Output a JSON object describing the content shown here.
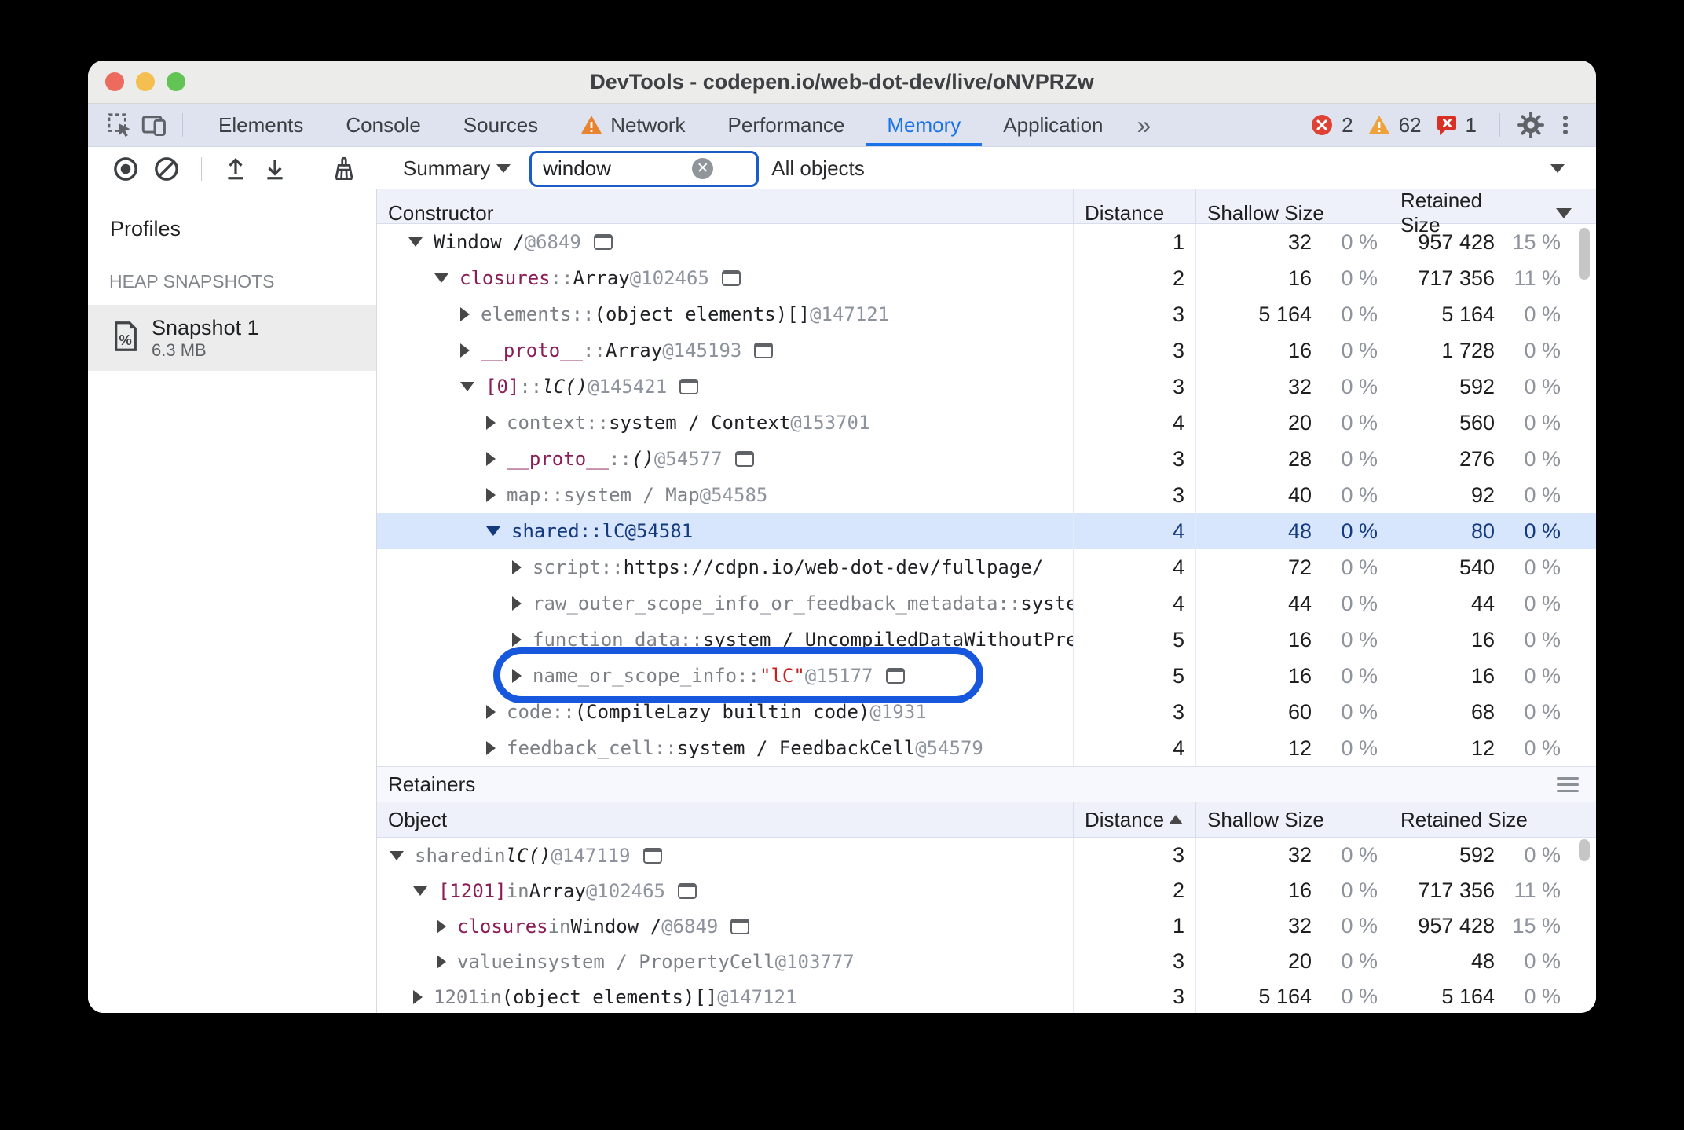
{
  "window": {
    "title": "DevTools - codepen.io/web-dot-dev/live/oNVPRZw"
  },
  "tabbar": {
    "tabs": [
      {
        "label": "Elements"
      },
      {
        "label": "Console"
      },
      {
        "label": "Sources"
      },
      {
        "label": "Network",
        "warning": true
      },
      {
        "label": "Performance"
      },
      {
        "label": "Memory",
        "active": true
      },
      {
        "label": "Application"
      }
    ],
    "overflow_chevron": "»",
    "error_count": "2",
    "warning_count": "62",
    "issue_count": "1"
  },
  "toolbar": {
    "profile_view": "Summary",
    "search_value": "window",
    "filter": "All objects"
  },
  "sidebar": {
    "heading": "Profiles",
    "section": "HEAP SNAPSHOTS",
    "snapshot_name": "Snapshot 1",
    "snapshot_size": "6.3 MB"
  },
  "constructors": {
    "columns": {
      "constructor": "Constructor",
      "distance": "Distance",
      "shallow": "Shallow Size",
      "retained": "Retained Size"
    },
    "sort": {
      "column": "Retained Size",
      "direction": "desc"
    },
    "rows": [
      {
        "indent": 0,
        "state": "expanded",
        "box": true,
        "segments": [
          [
            "Window /  ",
            "obj"
          ],
          [
            "@6849",
            "id"
          ]
        ],
        "distance": "1",
        "shallow": "32",
        "shallow_pct": "0 %",
        "retained": "957 428",
        "retained_pct": "15 %"
      },
      {
        "indent": 1,
        "state": "expanded",
        "box": true,
        "segments": [
          [
            "closures",
            "name"
          ],
          [
            " :: ",
            "gray"
          ],
          [
            "Array",
            "obj"
          ],
          [
            " @102465",
            "id"
          ]
        ],
        "distance": "2",
        "shallow": "16",
        "shallow_pct": "0 %",
        "retained": "717 356",
        "retained_pct": "11 %"
      },
      {
        "indent": 2,
        "state": "collapsed",
        "segments": [
          [
            "elements",
            "gray"
          ],
          [
            " :: ",
            "gray"
          ],
          [
            "(object elements)[]",
            "obj"
          ],
          [
            " @147121",
            "id"
          ]
        ],
        "distance": "3",
        "shallow": "5 164",
        "shallow_pct": "0 %",
        "retained": "5 164",
        "retained_pct": "0 %"
      },
      {
        "indent": 2,
        "state": "collapsed",
        "box": true,
        "segments": [
          [
            "__proto__",
            "name"
          ],
          [
            " :: ",
            "gray"
          ],
          [
            "Array",
            "obj"
          ],
          [
            " @145193",
            "id"
          ]
        ],
        "distance": "3",
        "shallow": "16",
        "shallow_pct": "0 %",
        "retained": "1 728",
        "retained_pct": "0 %"
      },
      {
        "indent": 2,
        "state": "expanded",
        "box": true,
        "segments": [
          [
            "[0]",
            "name"
          ],
          [
            " :: ",
            "gray"
          ],
          [
            "lC()",
            "it"
          ],
          [
            " @145421",
            "id"
          ]
        ],
        "distance": "3",
        "shallow": "32",
        "shallow_pct": "0 %",
        "retained": "592",
        "retained_pct": "0 %"
      },
      {
        "indent": 3,
        "state": "collapsed",
        "segments": [
          [
            "context",
            "gray"
          ],
          [
            " :: ",
            "gray"
          ],
          [
            "system / Context",
            "obj"
          ],
          [
            " @153701",
            "id"
          ]
        ],
        "distance": "4",
        "shallow": "20",
        "shallow_pct": "0 %",
        "retained": "560",
        "retained_pct": "0 %"
      },
      {
        "indent": 3,
        "state": "collapsed",
        "box": true,
        "segments": [
          [
            "__proto__",
            "name"
          ],
          [
            " :: ",
            "gray"
          ],
          [
            "()",
            "it"
          ],
          [
            " @54577",
            "id"
          ]
        ],
        "distance": "3",
        "shallow": "28",
        "shallow_pct": "0 %",
        "retained": "276",
        "retained_pct": "0 %"
      },
      {
        "indent": 3,
        "state": "collapsed",
        "segments": [
          [
            "map",
            "gray"
          ],
          [
            " :: ",
            "gray"
          ],
          [
            "system / Map",
            "gray"
          ],
          [
            " @54585",
            "id"
          ]
        ],
        "distance": "3",
        "shallow": "40",
        "shallow_pct": "0 %",
        "retained": "92",
        "retained_pct": "0 %"
      },
      {
        "indent": 3,
        "state": "expanded",
        "selected": true,
        "segments": [
          [
            "shared",
            "obj"
          ],
          [
            " :: ",
            "gray"
          ],
          [
            "lC",
            "obj"
          ],
          [
            " @54581",
            "id"
          ]
        ],
        "distance": "4",
        "shallow": "48",
        "shallow_pct": "0 %",
        "retained": "80",
        "retained_pct": "0 %"
      },
      {
        "indent": 4,
        "state": "collapsed",
        "segments": [
          [
            "script",
            "gray"
          ],
          [
            " :: ",
            "gray"
          ],
          [
            "https://cdpn.io/web-dot-dev/fullpage/",
            "obj"
          ]
        ],
        "distance": "4",
        "shallow": "72",
        "shallow_pct": "0 %",
        "retained": "540",
        "retained_pct": "0 %"
      },
      {
        "indent": 4,
        "state": "collapsed",
        "segments": [
          [
            "raw_outer_scope_info_or_feedback_metadata",
            "gray"
          ],
          [
            " :: ",
            "gray"
          ],
          [
            "system /",
            "obj"
          ]
        ],
        "distance": "4",
        "shallow": "44",
        "shallow_pct": "0 %",
        "retained": "44",
        "retained_pct": "0 %"
      },
      {
        "indent": 4,
        "state": "collapsed",
        "segments": [
          [
            "function_data",
            "gray"
          ],
          [
            " :: ",
            "gray"
          ],
          [
            "system / UncompiledDataWithoutPreparseData",
            "obj"
          ]
        ],
        "distance": "5",
        "shallow": "16",
        "shallow_pct": "0 %",
        "retained": "16",
        "retained_pct": "0 %"
      },
      {
        "indent": 4,
        "state": "collapsed",
        "annotated": true,
        "box": true,
        "segments": [
          [
            "name_or_scope_info",
            "gray"
          ],
          [
            " :: ",
            "gray"
          ],
          [
            "\"lC\"",
            "str"
          ],
          [
            " @15177",
            "id"
          ]
        ],
        "distance": "5",
        "shallow": "16",
        "shallow_pct": "0 %",
        "retained": "16",
        "retained_pct": "0 %"
      },
      {
        "indent": 3,
        "state": "collapsed",
        "segments": [
          [
            "code",
            "gray"
          ],
          [
            " :: ",
            "gray"
          ],
          [
            "(CompileLazy builtin code)",
            "obj"
          ],
          [
            " @1931",
            "id"
          ]
        ],
        "distance": "3",
        "shallow": "60",
        "shallow_pct": "0 %",
        "retained": "68",
        "retained_pct": "0 %"
      },
      {
        "indent": 3,
        "state": "collapsed",
        "segments": [
          [
            "feedback_cell",
            "gray"
          ],
          [
            " :: ",
            "gray"
          ],
          [
            "system / FeedbackCell",
            "obj"
          ],
          [
            " @54579",
            "id"
          ]
        ],
        "distance": "4",
        "shallow": "12",
        "shallow_pct": "0 %",
        "retained": "12",
        "retained_pct": "0 %"
      }
    ]
  },
  "retainers": {
    "title": "Retainers",
    "columns": {
      "object": "Object",
      "distance": "Distance",
      "shallow": "Shallow Size",
      "retained": "Retained Size"
    },
    "sort": {
      "column": "Distance",
      "direction": "asc"
    },
    "rows": [
      {
        "indent": 0,
        "state": "expanded",
        "box": true,
        "segments": [
          [
            "shared",
            "gray"
          ],
          [
            " in ",
            "gray"
          ],
          [
            "lC()",
            "it"
          ],
          [
            " @147119",
            "id"
          ]
        ],
        "distance": "3",
        "shallow": "32",
        "shallow_pct": "0 %",
        "retained": "592",
        "retained_pct": "0 %"
      },
      {
        "indent": 1,
        "state": "expanded",
        "box": true,
        "segments": [
          [
            "[1201]",
            "name"
          ],
          [
            " in ",
            "gray"
          ],
          [
            "Array",
            "obj"
          ],
          [
            " @102465",
            "id"
          ]
        ],
        "distance": "2",
        "shallow": "16",
        "shallow_pct": "0 %",
        "retained": "717 356",
        "retained_pct": "11 %"
      },
      {
        "indent": 2,
        "state": "collapsed",
        "box": true,
        "segments": [
          [
            "closures",
            "name"
          ],
          [
            " in ",
            "gray"
          ],
          [
            "Window /  ",
            "obj"
          ],
          [
            "@6849",
            "id"
          ]
        ],
        "distance": "1",
        "shallow": "32",
        "shallow_pct": "0 %",
        "retained": "957 428",
        "retained_pct": "15 %"
      },
      {
        "indent": 2,
        "state": "collapsed",
        "segments": [
          [
            "value",
            "gray"
          ],
          [
            " in ",
            "gray"
          ],
          [
            "system / PropertyCell",
            "gray"
          ],
          [
            " @103777",
            "id"
          ]
        ],
        "distance": "3",
        "shallow": "20",
        "shallow_pct": "0 %",
        "retained": "48",
        "retained_pct": "0 %"
      },
      {
        "indent": 1,
        "state": "collapsed",
        "segments": [
          [
            "1201",
            "gray"
          ],
          [
            " in ",
            "gray"
          ],
          [
            "(object elements)[]",
            "obj"
          ],
          [
            " @147121",
            "id"
          ]
        ],
        "distance": "3",
        "shallow": "5 164",
        "shallow_pct": "0 %",
        "retained": "5 164",
        "retained_pct": "0 %"
      }
    ]
  },
  "annotation": {
    "shape": "oval",
    "color": "#1657dd",
    "target": "name_or_scope_info row"
  }
}
